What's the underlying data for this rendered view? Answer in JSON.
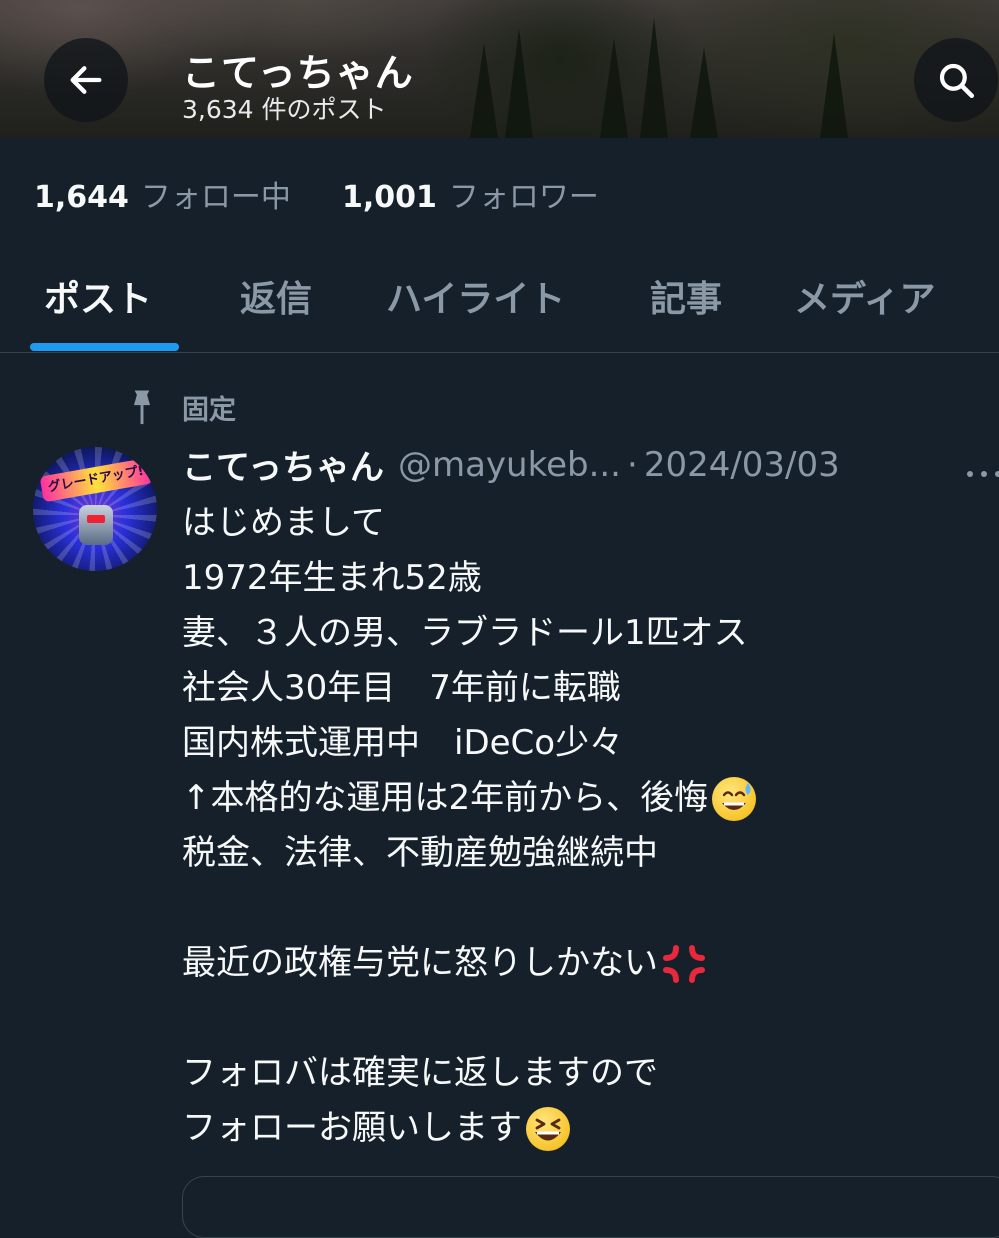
{
  "header": {
    "display_name": "こてっちゃん",
    "post_count": "3,634 件のポスト"
  },
  "stats": {
    "following_count": "1,644",
    "following_label": "フォロー中",
    "followers_count": "1,001",
    "followers_label": "フォロワー"
  },
  "tabs": [
    {
      "label": "ポスト",
      "active": true
    },
    {
      "label": "返信",
      "active": false
    },
    {
      "label": "ハイライト",
      "active": false
    },
    {
      "label": "記事",
      "active": false
    },
    {
      "label": "メディア",
      "active": false
    }
  ],
  "pinned_label": "固定",
  "tweet": {
    "name": "こてっちゃん",
    "handle": "@mayukeb...",
    "separator": "·",
    "date": "2024/03/03",
    "avatar_text": "グレードアップ!",
    "lines": [
      "はじめまして",
      "1972年生まれ52歳",
      "妻、３人の男、ラブラドール1匹オス",
      "社会人30年目　7年前に転職",
      "国内株式運用中　iDeCo少々",
      "↑本格的な運用は2年前から、後悔",
      "税金、法律、不動産勉強継続中",
      "",
      "最近の政権与党に怒りしかない",
      "",
      "フォロバは確実に返しますので",
      "フォローお願いします"
    ],
    "emojis": {
      "line_6": "sweat-smile-emoji",
      "line_9": "anger-symbol-emoji",
      "line_12": "laughing-emoji"
    }
  },
  "colors": {
    "background": "#15202b",
    "accent": "#1d9bf0",
    "secondary_text": "#8b98a5",
    "divider": "#38444d"
  }
}
